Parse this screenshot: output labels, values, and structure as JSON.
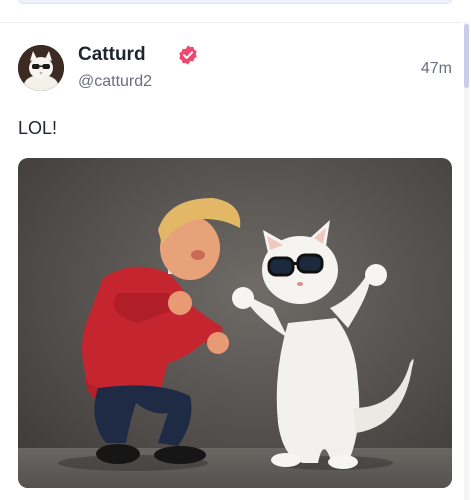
{
  "post": {
    "author_name": "Catturd",
    "handle": "@catturd2",
    "time": "47m",
    "text": "LOL!"
  },
  "icons": {
    "verified": "verified-badge-icon",
    "avatar": "avatar"
  },
  "colors": {
    "verified": "#f0486f",
    "name": "#1f2430",
    "muted": "#6b6f7b"
  }
}
